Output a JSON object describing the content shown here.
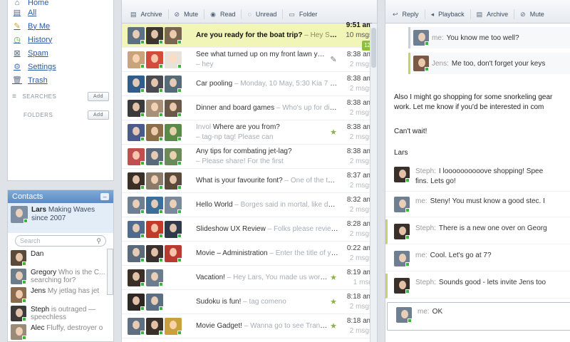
{
  "nav": {
    "items": [
      {
        "label": "Home",
        "icon": "home-icon"
      },
      {
        "label": "All",
        "icon": "inbox-icon"
      },
      {
        "label": "By Me",
        "icon": "pencil-icon"
      },
      {
        "label": "History",
        "icon": "clock-icon"
      },
      {
        "label": "Spam",
        "icon": "spam-icon"
      },
      {
        "label": "Settings",
        "icon": "wrench-icon"
      },
      {
        "label": "Trash",
        "icon": "trash-icon"
      }
    ],
    "searches_label": "SEARCHES",
    "folders_label": "FOLDERS",
    "add_label": "Add"
  },
  "contacts": {
    "title": "Contacts",
    "me": {
      "name": "Lars",
      "status": "Making Waves since 2007"
    },
    "search_placeholder": "Search",
    "list": [
      {
        "name": "Dan",
        "status": ""
      },
      {
        "name": "Gregory",
        "status": "Who is the C... searching for?"
      },
      {
        "name": "Jens",
        "status": "My jetlag has jet"
      },
      {
        "name": "Steph",
        "status": "is outraged — speechless"
      },
      {
        "name": "Alec",
        "status": "Fluffy, destroyer o"
      }
    ]
  },
  "toolbar": {
    "archive": "Archive",
    "mute": "Mute",
    "read": "Read",
    "unread": "Unread",
    "folder": "Folder"
  },
  "messages": [
    {
      "subject": "Are you ready for the boat trip?",
      "preview": "– Hey Steph, The boat",
      "time": "9:51 am",
      "count": "10 msgs",
      "badge": "12",
      "selected": true,
      "mark": ""
    },
    {
      "subject": "See what turned up on my front lawn yesterday!",
      "preview": "– hey",
      "time": "8:38 am",
      "count": "2 msgs",
      "mark": "✎"
    },
    {
      "subject": "Car pooling",
      "preview": "– Monday, 10 May, 5:30 Kia 7 seater, mazda, for",
      "time": "8:38 am",
      "count": "2 msgs",
      "mark": ""
    },
    {
      "subject": "Dinner and board games",
      "preview": "– Who's up for dinner and board",
      "time": "8:38 am",
      "count": "2 msgs",
      "mark": ""
    },
    {
      "subject": "Where are you from?",
      "preview": "– tag-np tag! Please can",
      "prefix": "Invol",
      "time": "8:38 am",
      "count": "2 msgs",
      "mark": "★"
    },
    {
      "subject": "Any tips for combating jet-lag?",
      "preview": "– Please share! For the first",
      "time": "8:38 am",
      "count": "2 msgs",
      "mark": ""
    },
    {
      "subject": "What is your favourite font?",
      "preview": "– One of the things I have been",
      "time": "8:37 am",
      "count": "2 msgs",
      "mark": ""
    },
    {
      "subject": "Hello World",
      "preview": "– Borges said in mortal, like do you like this",
      "time": "8:32 am",
      "count": "2 msgs",
      "mark": ""
    },
    {
      "subject": "Slideshow UX Review",
      "preview": "– Folks please review the latest",
      "time": "8:28 am",
      "count": "2 msgs",
      "mark": ""
    },
    {
      "subject": "Movie – Administration",
      "preview": "– Enter the title of your poll here",
      "time": "0:22 am",
      "count": "2 msgs",
      "mark": ""
    },
    {
      "subject": "Vacation!",
      "preview": "– Hey Lars, You made us work weeeeeeeeee",
      "time": "8:19 am",
      "count": "1 msg",
      "mark": "★"
    },
    {
      "subject": "Sudoku is fun!",
      "preview": "– tag comeno",
      "time": "8:18 am",
      "count": "2 msgs",
      "mark": "★"
    },
    {
      "subject": "Movie Gadget!",
      "preview": "– Wanna go to see Transformers and",
      "time": "8:18 am",
      "count": "2 msgs",
      "mark": "★"
    }
  ],
  "conversation": {
    "toolbar": {
      "reply": "Reply",
      "playback": "Playback",
      "archive": "Archive",
      "mute": "Mute"
    },
    "quote1": {
      "name": "me:",
      "text": "You know me too well?"
    },
    "quote2": {
      "name": "Jens:",
      "text": "Me too, don't forget your keys"
    },
    "para1": "Also I might go shopping for some snorkeling gear",
    "para2": "work. Let me know if you'd be interested in com",
    "para3": "Can't wait!",
    "para4": "Lars",
    "chats": [
      {
        "name": "Steph:",
        "text": "I loooooooooove shopping! Spee",
        "text2": "fins. Lets go!",
        "hl": false
      },
      {
        "name": "me:",
        "text": "Steny! You must know a good stec. I",
        "hl": false
      },
      {
        "name": "Steph:",
        "text": "There is a new one over on Georg",
        "hl": true
      },
      {
        "name": "me:",
        "text": "Cool. Let's go at 7?",
        "hl": false
      },
      {
        "name": "Steph:",
        "text": "Sounds good - lets invite Jens too",
        "hl": true
      },
      {
        "name": "me:",
        "text": "OK",
        "hl": false
      }
    ]
  },
  "colors": {
    "accent": "#5b8bc2",
    "selected_row": "#f2f5b8",
    "online": "#3cb53c",
    "highlight_bar": "#c6d16b"
  }
}
